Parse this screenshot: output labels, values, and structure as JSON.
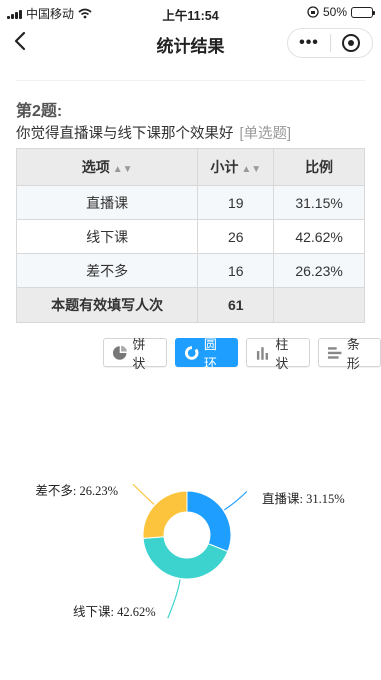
{
  "status": {
    "carrier": "中国移动",
    "time": "上午11:54",
    "battery": "50%",
    "battery_level": 0.5
  },
  "nav": {
    "title": "统计结果"
  },
  "question": {
    "number": "第2题:",
    "text": "你觉得直播课与线下课那个效果好",
    "type": "[单选题]"
  },
  "table": {
    "headers": [
      "选项",
      "小计",
      "比例"
    ],
    "rows": [
      {
        "option": "直播课",
        "count": "19",
        "ratio": "31.15%"
      },
      {
        "option": "线下课",
        "count": "26",
        "ratio": "42.62%"
      },
      {
        "option": "差不多",
        "count": "16",
        "ratio": "26.23%"
      }
    ],
    "total_label": "本题有效填写人次",
    "total_count": "61",
    "total_ratio": ""
  },
  "chart_tabs": {
    "pie": "饼状",
    "ring": "圆环",
    "bar": "柱状",
    "strip": "条形",
    "active": "ring"
  },
  "chart_data": {
    "type": "pie",
    "variant": "donut",
    "series": [
      {
        "name": "直播课",
        "value": 31.15,
        "label": "直播课: 31.15%",
        "color": "#1e9fff"
      },
      {
        "name": "线下课",
        "value": 42.62,
        "label": "线下课: 42.62%",
        "color": "#3cd3cf"
      },
      {
        "name": "差不多",
        "value": 26.23,
        "label": "差不多: 26.23%",
        "color": "#fbc43c"
      }
    ]
  },
  "colors": {
    "accent": "#1e9fff",
    "table_header": "#ebebeb",
    "row_alt": "#f4f8fb"
  }
}
